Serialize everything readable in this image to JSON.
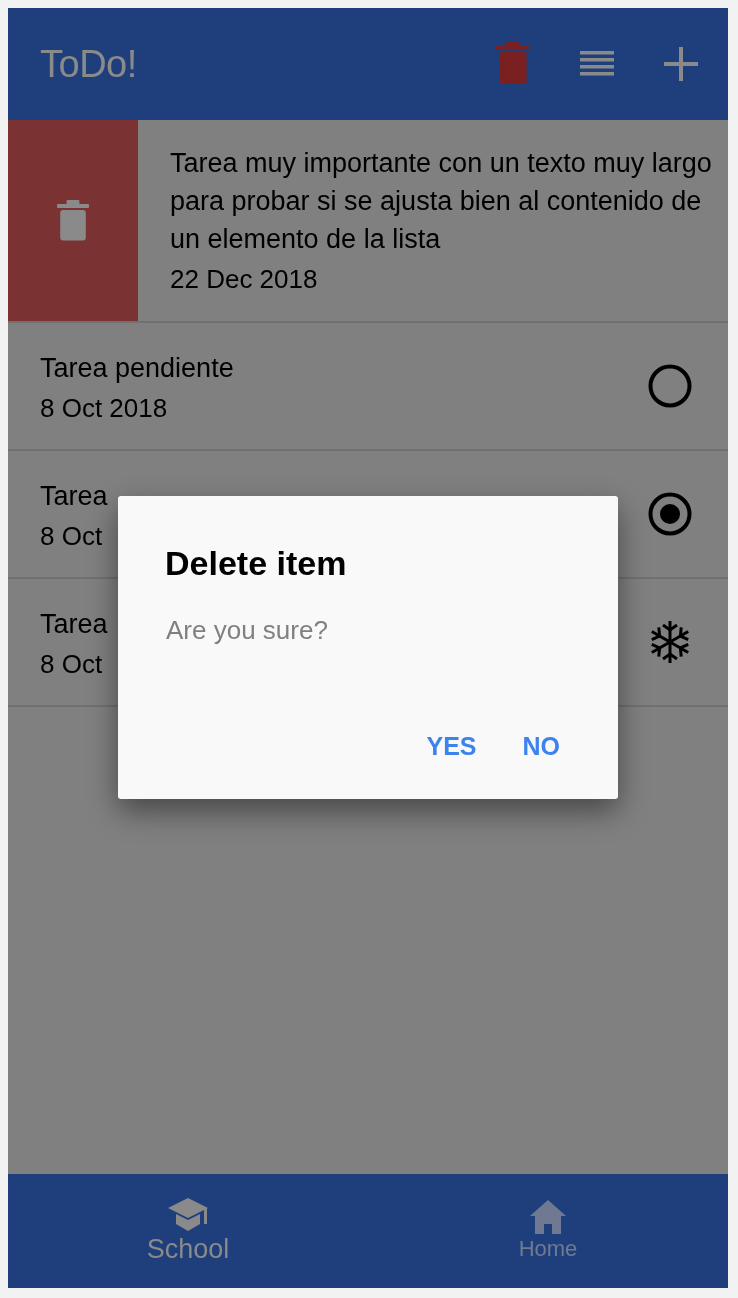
{
  "app_bar": {
    "title": "ToDo!",
    "actions": [
      {
        "kind": "delete",
        "active": true
      },
      {
        "kind": "list",
        "active": false
      },
      {
        "kind": "add",
        "active": false
      }
    ]
  },
  "tasks": [
    {
      "title": "Tarea muy importante con un texto muy largo para probar si se ajusta bien al contenido de un elemento de la lista",
      "date": "22 Dec 2018",
      "swiped": true
    },
    {
      "title": "Tarea pendiente",
      "date": "8 Oct 2018",
      "kind": "pending",
      "swiped": false
    },
    {
      "title": "Tarea",
      "date": "8 Oct",
      "kind": "done",
      "swiped": false
    },
    {
      "title": "Tarea",
      "date": "8 Oct",
      "kind": "frozen",
      "swiped": false
    }
  ],
  "dialog": {
    "title": "Delete item",
    "message": "Are you sure?",
    "buttons": [
      "YES",
      "NO"
    ]
  },
  "bottom_nav": [
    {
      "label": "School",
      "kind": "school",
      "selected": true
    },
    {
      "label": "Home",
      "kind": "home",
      "selected": false
    }
  ]
}
